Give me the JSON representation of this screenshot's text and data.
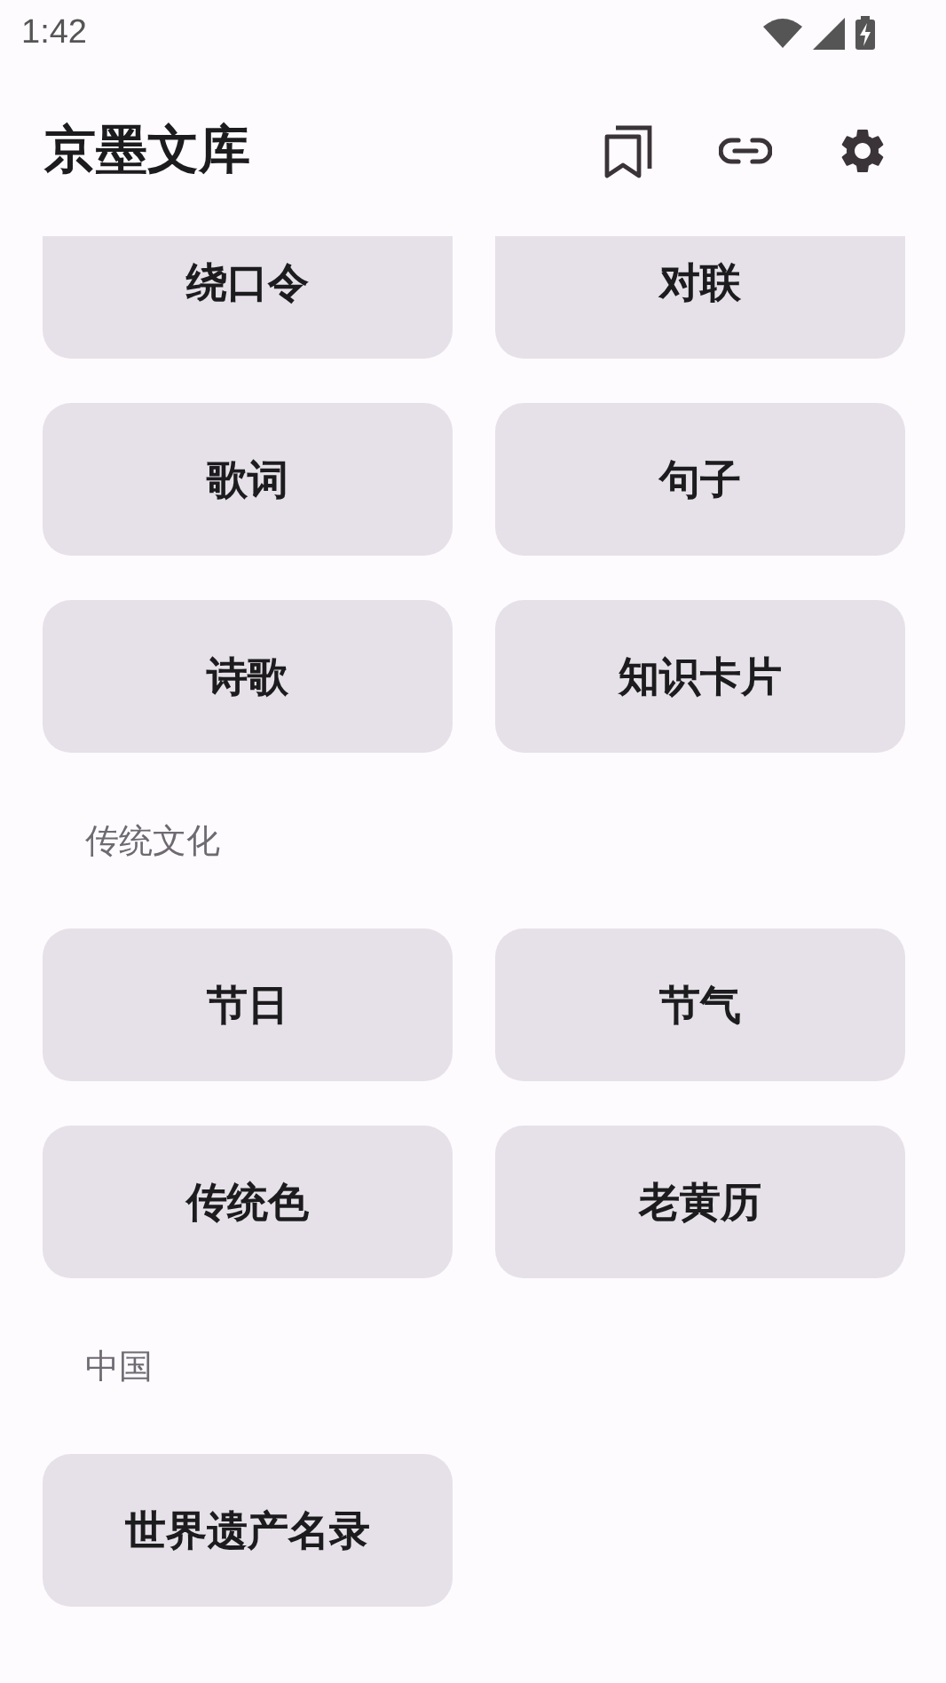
{
  "status_bar": {
    "time": "1:42"
  },
  "app_bar": {
    "title": "京墨文库"
  },
  "sections": [
    {
      "items": [
        "绕口令",
        "对联",
        "歌词",
        "句子",
        "诗歌",
        "知识卡片"
      ]
    },
    {
      "heading": "传统文化",
      "items": [
        "节日",
        "节气",
        "传统色",
        "老黄历"
      ]
    },
    {
      "heading": "中国",
      "items": [
        "世界遗产名录"
      ]
    }
  ]
}
